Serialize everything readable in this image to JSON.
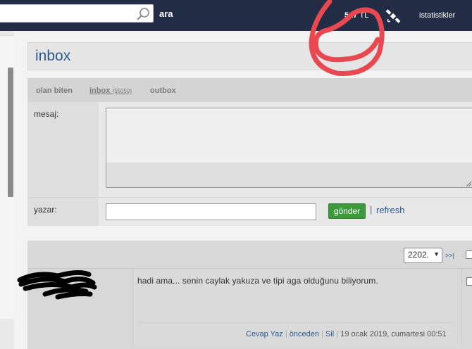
{
  "topbar": {
    "search_value": "",
    "search_button": "ara",
    "balance_amount": "517",
    "balance_currency": "TL",
    "stats_link": "istatistikler"
  },
  "inbox": {
    "title": "inbox",
    "tabs": [
      {
        "label": "olan biten"
      },
      {
        "label": "inbox",
        "count": "(55050)"
      },
      {
        "label": "outbox"
      }
    ]
  },
  "compose": {
    "message_label": "mesaj:",
    "message_value": "",
    "author_label": "yazar:",
    "author_value": "",
    "send_button": "gönder",
    "separator": "|",
    "refresh_link": "refresh"
  },
  "list": {
    "page_select_value": "2202.",
    "next_link": ">>|",
    "messages": [
      {
        "text": "hadi ama... senin caylak yakuza ve tipi aga olduğunu biliyorum.",
        "reply_link": "Cevap Yaz",
        "previous_link": "önceden",
        "delete_link": "Sil",
        "date": "19 ocak 2019, cumartesi 00:51"
      }
    ]
  },
  "colors": {
    "topbar": "#222c44",
    "link": "#2c5a8c",
    "send_button": "#3c9a3c",
    "annotation": "#e8484f"
  },
  "icons": [
    "search-icon",
    "satellite-icon",
    "textarea-resize-icon"
  ]
}
